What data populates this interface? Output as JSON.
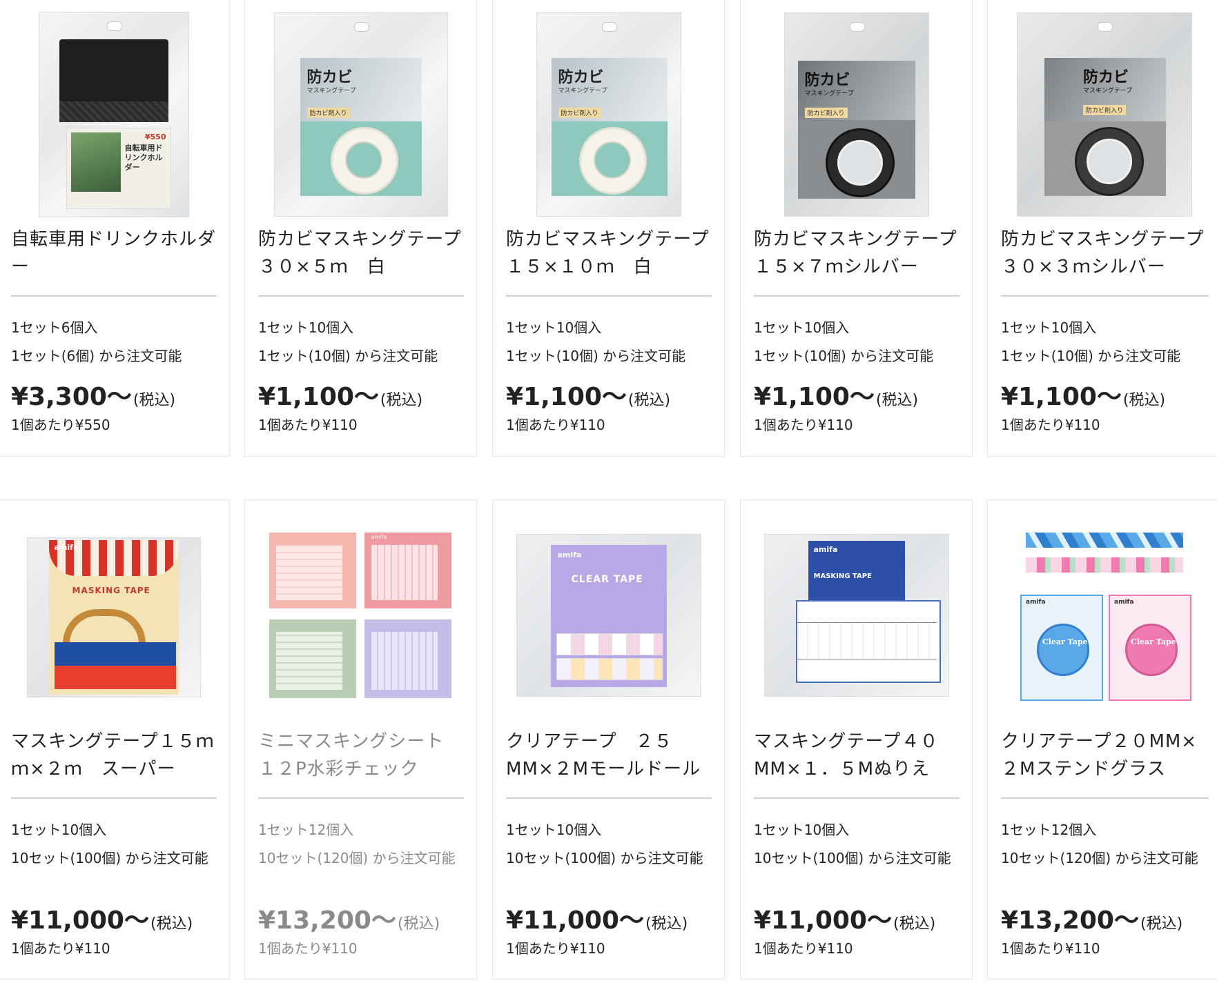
{
  "products": [
    {
      "title": "自転車用ドリンクホルダー",
      "lot": "1セット6個入",
      "min_order": "1セット(6個) から注文可能",
      "price": "¥3,300〜",
      "tax": "(税込)",
      "unit_price": "1個あたり¥550",
      "image_icon": "drink-holder-package",
      "image_colors": {
        "bag": "#1e1e1e",
        "card": "#f2efe6"
      },
      "pkg_text": {
        "price": "¥550",
        "name": "自転車用ドリンクホルダー"
      }
    },
    {
      "title": "防カビマスキングテープ　３０×５ｍ　白",
      "lot": "1セット10個入",
      "min_order": "1セット(10個) から注文可能",
      "price": "¥1,100〜",
      "tax": "(税込)",
      "unit_price": "1個あたり¥110",
      "image_icon": "masking-tape-white-package",
      "image_colors": {
        "card": "#8fc9bd",
        "roll": "#f5f3ea"
      },
      "pkg_text": {
        "brand": "防カビ",
        "sub": "マスキングテープ",
        "badge": "防カビ剤入り"
      }
    },
    {
      "title": "防カビマスキングテープ　１５×１０ｍ　白",
      "lot": "1セット10個入",
      "min_order": "1セット(10個) から注文可能",
      "price": "¥1,100〜",
      "tax": "(税込)",
      "unit_price": "1個あたり¥110",
      "image_icon": "masking-tape-white-package",
      "image_colors": {
        "card": "#8fc9bd",
        "roll": "#f5f3ea"
      },
      "pkg_text": {
        "brand": "防カビ",
        "sub": "マスキングテープ",
        "badge": "防カビ剤入り"
      }
    },
    {
      "title": "防カビマスキングテープ　１５×７ｍシルバー",
      "lot": "1セット10個入",
      "min_order": "1セット(10個) から注文可能",
      "price": "¥1,100〜",
      "tax": "(税込)",
      "unit_price": "1個あたり¥110",
      "image_icon": "masking-tape-silver-package",
      "image_colors": {
        "card": "#8a8d90",
        "roll": "#2a2a2a"
      },
      "pkg_text": {
        "brand": "防カビ",
        "sub": "マスキングテープ",
        "badge": "防カビ剤入り"
      }
    },
    {
      "title": "防カビマスキングテープ　３０×３ｍシルバー",
      "lot": "1セット10個入",
      "min_order": "1セット(10個) から注文可能",
      "price": "¥1,100〜",
      "tax": "(税込)",
      "unit_price": "1個あたり¥110",
      "image_icon": "masking-tape-silver-package",
      "image_colors": {
        "card": "#9a9c9e",
        "roll": "#3a3a3a"
      },
      "pkg_text": {
        "brand": "防カビ",
        "sub": "マスキングテープ",
        "badge": "防カビ剤入り"
      }
    },
    {
      "title": "マスキングテープ１５ｍｍ×２ｍ　スーパー",
      "lot": "1セット10個入",
      "min_order": "10セット(100個) から注文可能",
      "price": "¥11,000〜",
      "tax": "(税込)",
      "unit_price": "1個あたり¥110",
      "image_icon": "masking-tape-supermarket-package",
      "image_colors": {
        "card": "#f4e3b5",
        "accent": "#d8312a"
      },
      "pkg_text": {
        "brand": "amifa",
        "name": "MASKING TAPE"
      }
    },
    {
      "title": "ミニマスキングシート　１２P水彩チェック",
      "lot": "1セット12個入",
      "min_order": "10セット(120個) から注文可能",
      "price": "¥13,200〜",
      "tax": "(税込)",
      "unit_price": "1個あたり¥110",
      "dim": true,
      "image_icon": "mini-masking-sheet-package",
      "image_colors": {
        "pink": "#f3b7ae",
        "rose": "#ee9aa0",
        "green": "#b9cdb4",
        "lavender": "#c1bde6"
      },
      "pkg_text": {
        "brand": "amifa"
      }
    },
    {
      "title": "クリアテープ　２５MM×２Mモールドール",
      "lot": "1セット10個入",
      "min_order": "10セット(100個) から注文可能",
      "price": "¥11,000〜",
      "tax": "(税込)",
      "unit_price": "1個あたり¥110",
      "image_icon": "clear-tape-mold-doll-package",
      "image_colors": {
        "card": "#b8a9e6",
        "accent": "#ffffff"
      },
      "pkg_text": {
        "brand": "amifa",
        "name": "CLEAR TAPE"
      }
    },
    {
      "title": "マスキングテープ４０MM×１．５Mぬりえ",
      "lot": "1セット10個入",
      "min_order": "10セット(100個) から注文可能",
      "price": "¥11,000〜",
      "tax": "(税込)",
      "unit_price": "1個あたり¥110",
      "image_icon": "masking-tape-coloring-package",
      "image_colors": {
        "card": "#2d4fa8",
        "band": "#ffffff"
      },
      "pkg_text": {
        "brand": "amifa",
        "name": "MASKING TAPE"
      }
    },
    {
      "title": "クリアテープ２０MM×２Mステンドグラス",
      "lot": "1セット12個入",
      "min_order": "10セット(120個) から注文可能",
      "price": "¥13,200〜",
      "tax": "(税込)",
      "unit_price": "1個あたり¥110",
      "image_icon": "clear-tape-stained-glass-package",
      "image_colors": {
        "blue": "#5aa8e6",
        "pink": "#ef7bb0"
      },
      "pkg_text": {
        "brand": "amifa",
        "name": "Clear Tape"
      }
    }
  ]
}
